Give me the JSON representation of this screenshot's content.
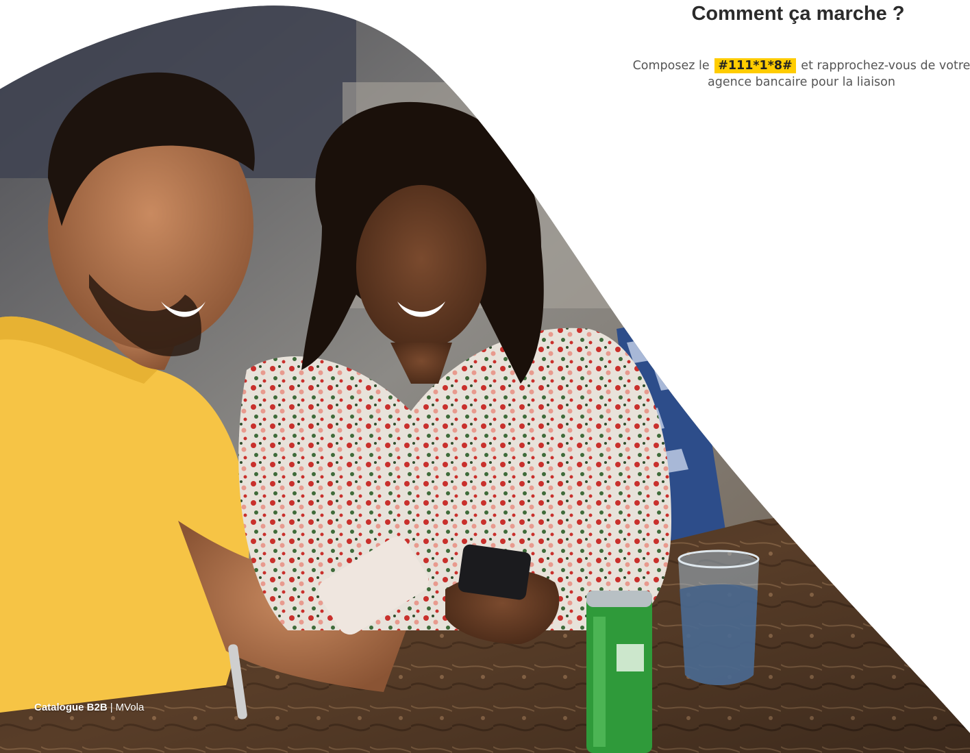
{
  "heading": "Comment ça marche ?",
  "instructions": {
    "prefix": "Composez le",
    "code": "#111*1*8#",
    "suffix_line1": "et rapprochez-vous de votre",
    "suffix_line2": "agence bancaire pour la liaison"
  },
  "photo": {
    "description_icon": "photo-couple-smartphone",
    "shirt_color": "#f6c445",
    "accent_color": "#ffcc00"
  },
  "footer": {
    "brand": "Catalogue B2B",
    "separator": "|",
    "product": "MVola"
  }
}
